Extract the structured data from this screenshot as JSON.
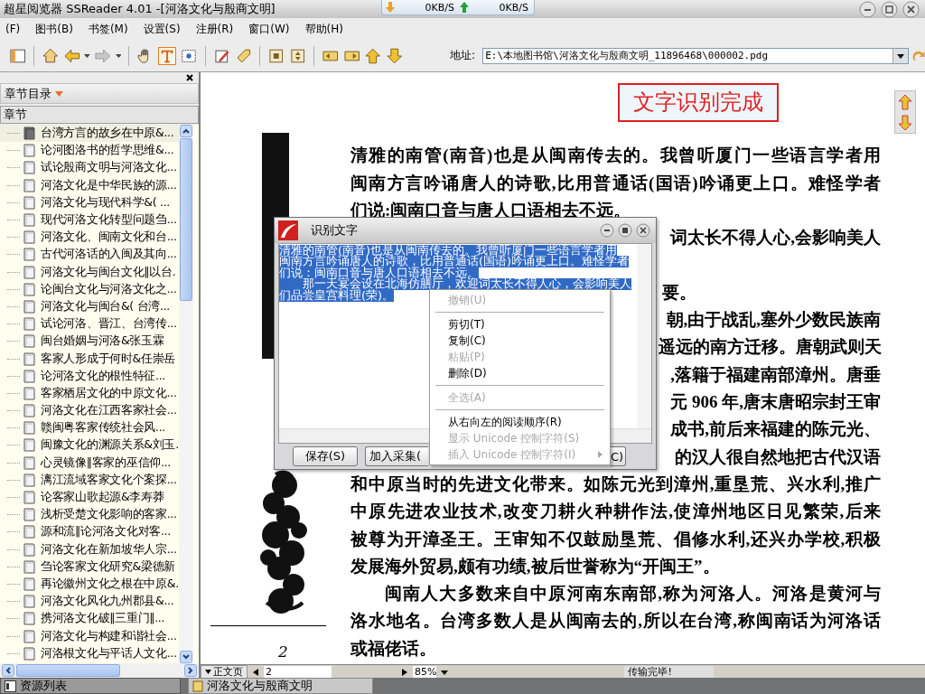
{
  "window": {
    "title": "超星阅览器 SSReader 4.01 -[河洛文化与殷商文明]",
    "download_speed": "0KB/S",
    "upload_speed": "0KB/S"
  },
  "menu": [
    "(F)",
    "图书(B)",
    "书签(M)",
    "设置(S)",
    "注册(R)",
    "窗口(W)",
    "帮助(H)"
  ],
  "toolbar": {
    "tools": [
      {
        "kind": "hand",
        "selected": false
      },
      {
        "kind": "text",
        "selected": true
      },
      {
        "kind": "region",
        "selected": false
      }
    ],
    "address_label": "地址:",
    "address": "E:\\本地图书馆\\河洛文化与殷商文明_11896468\\000002.pdg"
  },
  "sidebar": {
    "title": "章节目录",
    "column": "章节",
    "items": [
      {
        "label": "台湾方言的故乡在中原&...",
        "selected": true
      },
      {
        "label": "论河图洛书的哲学思维&...",
        "selected": false
      },
      {
        "label": "试论殷商文明与河洛文化...",
        "selected": false
      },
      {
        "label": "河洛文化是中华民族的源...",
        "selected": false
      },
      {
        "label": "河洛文化与现代科学&( ...",
        "selected": false
      },
      {
        "label": "现代河洛文化转型问题刍...",
        "selected": false
      },
      {
        "label": "河洛文化、闽南文化和台...",
        "selected": false
      },
      {
        "label": "古代河洛话的入闽及其向...",
        "selected": false
      },
      {
        "label": "河洛文化与闽台文化‖以台.",
        "selected": false
      },
      {
        "label": "论闽台文化与河洛文化之...",
        "selected": false
      },
      {
        "label": "河洛文化与闽台&( 台湾...",
        "selected": false
      },
      {
        "label": "试论河洛、晋江、台湾传...",
        "selected": false
      },
      {
        "label": "闽台婚姻与河洛&张玉霖",
        "selected": false
      },
      {
        "label": "客家人形成于何时&任崇岳",
        "selected": false
      },
      {
        "label": "论河洛文化的根性特征...",
        "selected": false
      },
      {
        "label": "客家栖居文化的中原文化...",
        "selected": false
      },
      {
        "label": "河洛文化在江西客家社会...",
        "selected": false
      },
      {
        "label": "赣闽粤客家传统社会风...",
        "selected": false
      },
      {
        "label": "闽豫文化的渊源关系&刘玉.",
        "selected": false
      },
      {
        "label": "心灵镜像‖客家的巫信仰...",
        "selected": false
      },
      {
        "label": "漓江流域客家文化个案探...",
        "selected": false
      },
      {
        "label": "论客家山歌起源&李寿莽",
        "selected": false
      },
      {
        "label": "浅析受楚文化影响的客家...",
        "selected": false
      },
      {
        "label": "源和流‖论河洛文化对客...",
        "selected": false
      },
      {
        "label": "河洛文化在新加坡华人宗...",
        "selected": false
      },
      {
        "label": "刍论客家文化研究&梁德新",
        "selected": false
      },
      {
        "label": "再论徽州文化之根在中原&.",
        "selected": false
      },
      {
        "label": "河洛文化风化九州郡县&...",
        "selected": false
      },
      {
        "label": "携河洛文化破‖三重门‖...",
        "selected": false
      },
      {
        "label": "河洛文化与构建和谐社会...",
        "selected": false
      },
      {
        "label": "河洛根文化与平话人文化...",
        "selected": false
      }
    ]
  },
  "document": {
    "banner": "文字识别完成",
    "lines": [
      {
        "kind": "full",
        "text": "清雅的南管(南音)也是从闽南传去的。我曾听厦门一些语言学者用"
      },
      {
        "kind": "full",
        "text": "闽南方言吟诵唐人的诗歌,比用普通话(国语)吟诵更上口。难怪学者"
      },
      {
        "kind": "end",
        "text": "们说:闽南口音与唐人口语相去不远。"
      },
      {
        "kind": "partial",
        "text": "词太长不得人心,会影响美人"
      },
      {
        "kind": "partial_gap",
        "text": "要。"
      },
      {
        "kind": "partial",
        "text": "朝,由于战乱,塞外少数民族南"
      },
      {
        "kind": "partial",
        "text": "遥远的南方迁移。唐朝武则天"
      },
      {
        "kind": "partial",
        "text": ",落籍于福建南部漳州。唐垂"
      },
      {
        "kind": "partial",
        "text": "元 906 年,唐末唐昭宗封王审"
      },
      {
        "kind": "partial",
        "text": "成书,前后来福建的陈元光、"
      },
      {
        "kind": "partial",
        "text": "的汉人很自然地把古代汉语"
      },
      {
        "kind": "full",
        "text": "和中原当时的先进文化带来。如陈元光到漳州,重垦荒、兴水利,推广"
      },
      {
        "kind": "full",
        "text": "中原先进农业技术,改变刀耕火种耕作法,使漳州地区日见繁荣,后来"
      },
      {
        "kind": "full",
        "text": "被尊为开漳圣王。王审知不仅鼓励垦荒、倡修水利,还兴办学校,积极"
      },
      {
        "kind": "end",
        "text": "发展海外贸易,颇有功绩,被后世誉称为“开闽王”。"
      },
      {
        "kind": "indent",
        "text": "闽南人大多数来自中原河南东南部,称为河洛人。河洛是黄河与"
      },
      {
        "kind": "full",
        "text": "洛水地名。台湾多数人是从闽南去的,所以在台湾,称闽南话为河洛话"
      },
      {
        "kind": "end",
        "text": "或福佬话。"
      }
    ],
    "page_number": "2"
  },
  "status": {
    "view": "正文页",
    "page": "2",
    "zoom": "85%",
    "message": "传输完毕!"
  },
  "dialog": {
    "title": "识别文字",
    "lines": [
      {
        "kind": "plain",
        "text": "清雅的南管(南音)也是从闽南传去的。我曾听厦门一些语言学者用"
      },
      {
        "kind": "plain",
        "text": "闽南方言吟诵唐人的诗歌，比用普通话(国语)吟诵更上口。难怪学者"
      },
      {
        "kind": "plain",
        "text": "们说：闽南口音与唐人口语相去不远。"
      },
      {
        "kind": "indent",
        "text": "那一天宴会设在北海仿膳厅，欢迎词太长不得人心，会影响美人"
      },
      {
        "kind": "plain",
        "text": "们品尝皇宫料理(荣)。"
      }
    ],
    "buttons": [
      "保存(S)",
      "加入采集(",
      "C)"
    ]
  },
  "context_menu": {
    "items": [
      {
        "kind": "item",
        "label": "撤销(U)",
        "disabled": true
      },
      {
        "kind": "separator"
      },
      {
        "kind": "item",
        "label": "剪切(T)",
        "disabled": false
      },
      {
        "kind": "item",
        "label": "复制(C)",
        "disabled": false
      },
      {
        "kind": "item",
        "label": "粘贴(P)",
        "disabled": true
      },
      {
        "kind": "item",
        "label": "删除(D)",
        "disabled": false
      },
      {
        "kind": "separator"
      },
      {
        "kind": "item",
        "label": "全选(A)",
        "disabled": true
      },
      {
        "kind": "separator"
      },
      {
        "kind": "item",
        "label": "从右向左的阅读顺序(R)",
        "disabled": false
      },
      {
        "kind": "item",
        "label": "显示 Unicode 控制字符(S)",
        "disabled": true
      },
      {
        "kind": "item",
        "label": "插入 Unicode 控制字符(I)",
        "disabled": true,
        "submenu": true
      }
    ]
  },
  "taskbar": {
    "items": [
      "资源列表",
      "河洛文化与殷商文明"
    ]
  }
}
